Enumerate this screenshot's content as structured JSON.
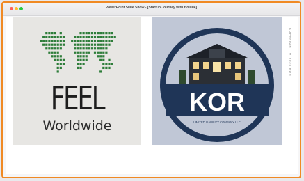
{
  "window": {
    "title": "PowerPoint Slide Show - [Startup Journey with Bolude]"
  },
  "slide_left": {
    "title": "FEEL",
    "subtitle": "Worldwide",
    "logo_icon": "world-map-dots-icon"
  },
  "slide_right": {
    "title": "KOR",
    "subtitle": "LIMITED LIABILITY COMPANY LLC",
    "logo_icon": "building-icon"
  },
  "side_note": "COPYRIGHT © 2025 KOR",
  "colors": {
    "window_border": "#f08a24",
    "kor_navy": "#1f3557",
    "kor_background": "#c0c7d6",
    "feel_dots": "#2e7d3a",
    "feel_background": "#e7e6e3"
  }
}
